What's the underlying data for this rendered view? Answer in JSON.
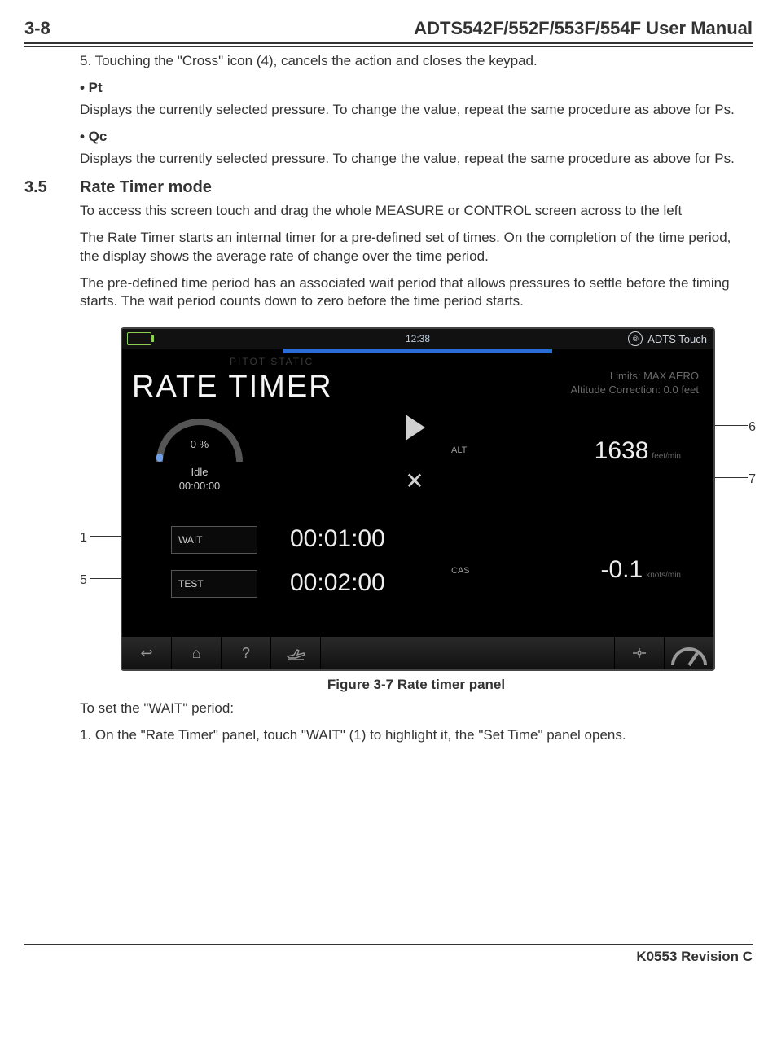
{
  "header": {
    "page_number": "3-8",
    "title": "ADTS542F/552F/553F/554F User Manual"
  },
  "body": {
    "step5": "5. Touching the \"Cross\" icon (4), cancels the action and closes the keypad.",
    "pt_label": "• Pt",
    "pt_text": "Displays the currently selected pressure. To change the value, repeat the same procedure as above for Ps.",
    "qc_label": "• Qc",
    "qc_text": "Displays the currently selected pressure. To change the value, repeat the same procedure as above for Ps.",
    "section_number": "3.5",
    "section_title": "Rate Timer mode",
    "p1": "To access this screen touch and drag the whole MEASURE or CONTROL screen across to the left",
    "p2": "The Rate Timer starts an internal timer for a pre-defined set of times. On the completion of the time period, the display shows the average rate of change over the time period.",
    "p3": "The pre-defined time period has an associated wait period that allows pressures to settle before the timing starts. The wait period counts down to zero before the time period starts.",
    "figure_caption": "Figure 3-7 Rate timer panel",
    "post1": "To set the \"WAIT\" period:",
    "post2": "1. On the \"Rate Timer\" panel, touch \"WAIT\" (1) to highlight it, the \"Set Time\" panel opens."
  },
  "device": {
    "time": "12:38",
    "brand": "ADTS Touch",
    "pitot": "PITOT STATIC",
    "title": "RATE TIMER",
    "limits_line1": "Limits: MAX AERO",
    "limits_line2": "Altitude Correction: 0.0 feet",
    "gauge_percent": "0 %",
    "gauge_idle": "Idle",
    "gauge_time": "00:00:00",
    "alt_label": "ALT",
    "alt_value": "1638",
    "alt_unit": "feet/min",
    "cas_label": "CAS",
    "cas_value": "-0.1",
    "cas_unit": "knots/min",
    "wait_label": "WAIT",
    "wait_value": "00:01:00",
    "test_label": "TEST",
    "test_value": "00:02:00"
  },
  "callouts": {
    "c1": "1",
    "c5": "5",
    "c6": "6",
    "c7": "7"
  },
  "footer": {
    "revision": "K0553 Revision C"
  }
}
